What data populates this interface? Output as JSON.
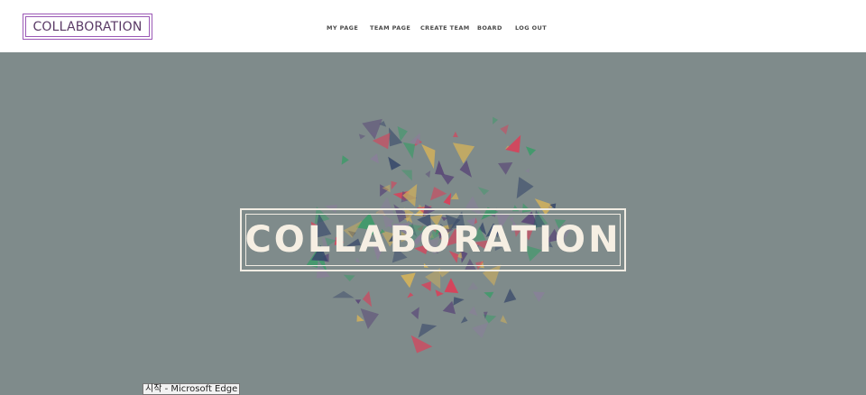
{
  "navbar": {
    "brand": "COLLABORATION",
    "menu": [
      {
        "label": "MY PAGE"
      },
      {
        "label": "TEAM PAGE"
      },
      {
        "label": "CREATE TEAM"
      },
      {
        "label": "BOARD"
      },
      {
        "label": "LOG OUT"
      }
    ]
  },
  "hero": {
    "title": "COLLABORATION",
    "background_color": "#7f8b8b",
    "particle_colors": [
      "#d9415a",
      "#3a4a6b",
      "#d4b25a",
      "#3f9a6a",
      "#5b4a78",
      "#8a7f9a"
    ]
  },
  "tooltip": {
    "text": "시작 - Microsoft Edge"
  },
  "colors": {
    "brand_border": "#9b59b6",
    "brand_text": "#5a3a66",
    "hero_text": "#f6efe3"
  }
}
